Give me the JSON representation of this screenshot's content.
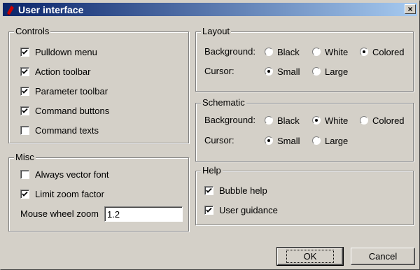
{
  "window": {
    "title": "User interface",
    "close_label": "×"
  },
  "controls": {
    "label": "Controls",
    "items": [
      {
        "label": "Pulldown menu",
        "checked": true
      },
      {
        "label": "Action toolbar",
        "checked": true
      },
      {
        "label": "Parameter toolbar",
        "checked": true
      },
      {
        "label": "Command buttons",
        "checked": true
      },
      {
        "label": "Command texts",
        "checked": false
      }
    ]
  },
  "misc": {
    "label": "Misc",
    "items": [
      {
        "label": "Always vector font",
        "checked": false
      },
      {
        "label": "Limit zoom factor",
        "checked": true
      }
    ],
    "zoom_label": "Mouse wheel zoom",
    "zoom_value": "1.2"
  },
  "layout": {
    "label": "Layout",
    "background_label": "Background:",
    "background_options": [
      "Black",
      "White",
      "Colored"
    ],
    "background_selected": "Colored",
    "cursor_label": "Cursor:",
    "cursor_options": [
      "Small",
      "Large"
    ],
    "cursor_selected": "Small"
  },
  "schematic": {
    "label": "Schematic",
    "background_label": "Background:",
    "background_options": [
      "Black",
      "White",
      "Colored"
    ],
    "background_selected": "White",
    "cursor_label": "Cursor:",
    "cursor_options": [
      "Small",
      "Large"
    ],
    "cursor_selected": "Small"
  },
  "help": {
    "label": "Help",
    "items": [
      {
        "label": "Bubble help",
        "checked": true
      },
      {
        "label": "User guidance",
        "checked": true
      }
    ]
  },
  "buttons": {
    "ok": "OK",
    "cancel": "Cancel"
  },
  "colors": {
    "face": "#d4d0c8",
    "title_start": "#0a246a",
    "title_end": "#a6caf0",
    "icon": "#cc0000"
  }
}
